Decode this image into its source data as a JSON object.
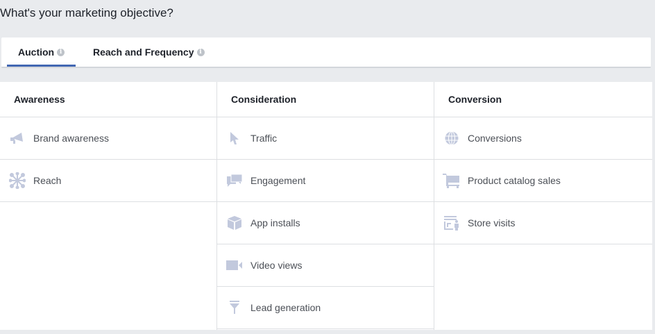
{
  "title": "What's your marketing objective?",
  "tabs": [
    {
      "label": "Auction",
      "active": true
    },
    {
      "label": "Reach and Frequency",
      "active": false
    }
  ],
  "info_glyph": "i",
  "icon_color": "#c2c9dd",
  "columns": [
    {
      "heading": "Awareness",
      "items": [
        {
          "label": "Brand awareness",
          "icon": "megaphone-icon"
        },
        {
          "label": "Reach",
          "icon": "reach-icon"
        }
      ]
    },
    {
      "heading": "Consideration",
      "items": [
        {
          "label": "Traffic",
          "icon": "cursor-icon"
        },
        {
          "label": "Engagement",
          "icon": "chat-bubbles-icon"
        },
        {
          "label": "App installs",
          "icon": "box-icon"
        },
        {
          "label": "Video views",
          "icon": "video-camera-icon"
        },
        {
          "label": "Lead generation",
          "icon": "funnel-icon"
        }
      ]
    },
    {
      "heading": "Conversion",
      "items": [
        {
          "label": "Conversions",
          "icon": "globe-icon"
        },
        {
          "label": "Product catalog sales",
          "icon": "shopping-cart-icon"
        },
        {
          "label": "Store visits",
          "icon": "store-icon"
        }
      ]
    }
  ]
}
